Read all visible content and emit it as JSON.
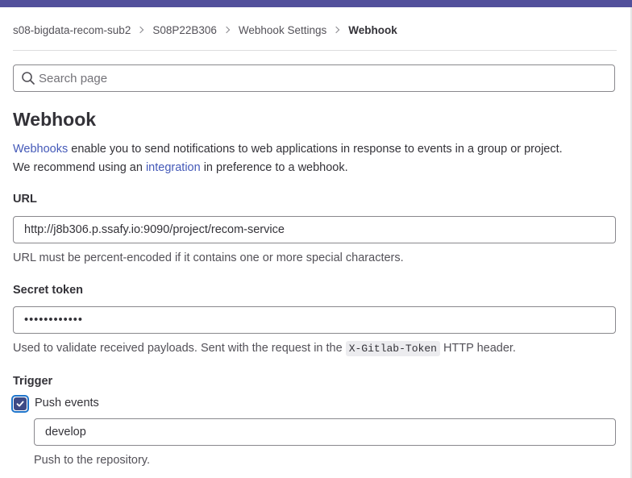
{
  "breadcrumb": {
    "items": [
      "s08-bigdata-recom-sub2",
      "S08P22B306",
      "Webhook Settings"
    ],
    "current": "Webhook"
  },
  "search": {
    "placeholder": "Search page",
    "value": ""
  },
  "page": {
    "title": "Webhook",
    "intro": {
      "link1": "Webhooks",
      "text1": " enable you to send notifications to web applications in response to events in a group or project.",
      "text2": "We recommend using an ",
      "link2": "integration",
      "text3": " in preference to a webhook."
    }
  },
  "url_field": {
    "label": "URL",
    "value": "http://j8b306.p.ssafy.io:9090/project/recom-service",
    "help": "URL must be percent-encoded if it contains one or more special characters."
  },
  "secret_token": {
    "label": "Secret token",
    "value": "••••••••••••",
    "help_before": "Used to validate received payloads. Sent with the request in the ",
    "help_code": "X-Gitlab-Token",
    "help_after": " HTTP header."
  },
  "trigger": {
    "label": "Trigger",
    "push_events": {
      "label": "Push events",
      "checked": true,
      "branch_value": "develop",
      "help": "Push to the repository."
    }
  },
  "colors": {
    "topbar": "#52509b",
    "link": "#4459b8",
    "checkbox": "#3e4a86",
    "focus_ring": "#1f75cb"
  }
}
